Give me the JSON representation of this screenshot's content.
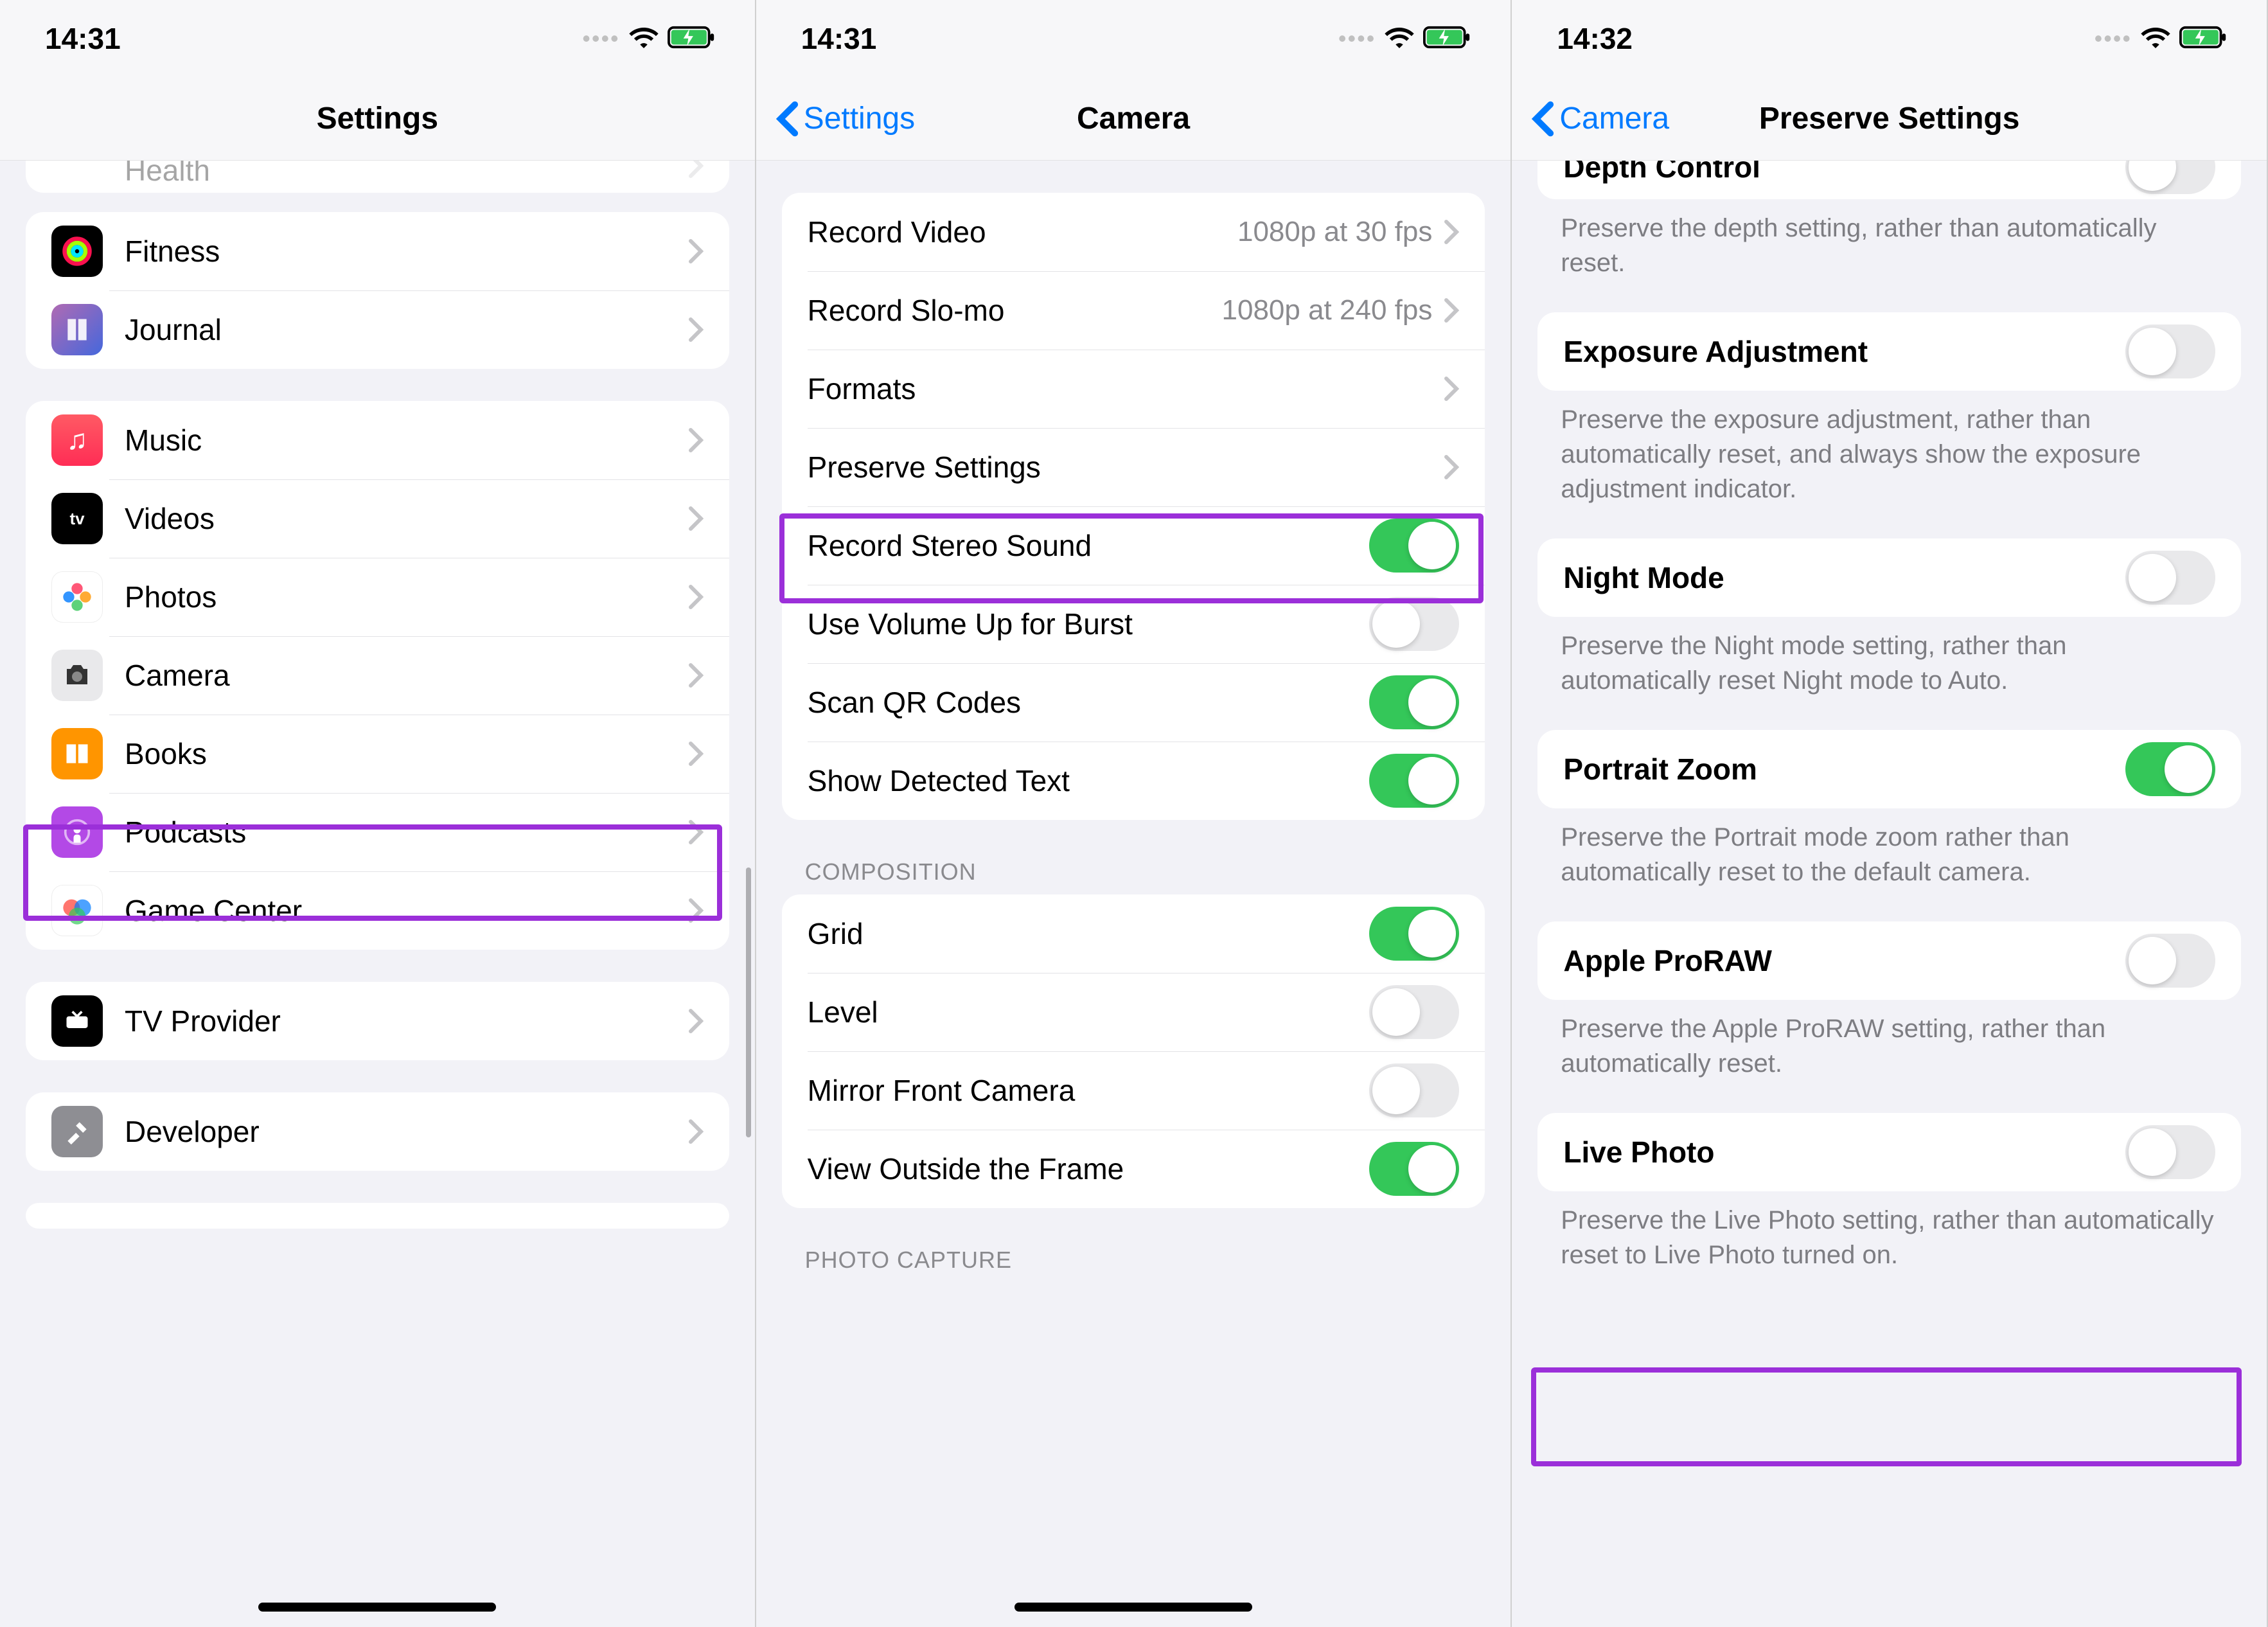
{
  "status": {
    "time1": "14:31",
    "time2": "14:31",
    "time3": "14:32"
  },
  "screen1": {
    "title": "Settings",
    "peek": "Health",
    "group1": [
      {
        "label": "Fitness"
      },
      {
        "label": "Journal"
      }
    ],
    "group2": [
      {
        "label": "Music"
      },
      {
        "label": "Videos"
      },
      {
        "label": "Photos"
      },
      {
        "label": "Camera"
      },
      {
        "label": "Books"
      },
      {
        "label": "Podcasts"
      },
      {
        "label": "Game Center"
      }
    ],
    "group3": [
      {
        "label": "TV Provider"
      }
    ],
    "group4": [
      {
        "label": "Developer"
      }
    ]
  },
  "screen2": {
    "back": "Settings",
    "title": "Camera",
    "group1": [
      {
        "label": "Record Video",
        "detail": "1080p at 30 fps"
      },
      {
        "label": "Record Slo-mo",
        "detail": "1080p at 240 fps"
      },
      {
        "label": "Formats"
      },
      {
        "label": "Preserve Settings"
      },
      {
        "label": "Record Stereo Sound",
        "toggle": true
      },
      {
        "label": "Use Volume Up for Burst",
        "toggle": false
      },
      {
        "label": "Scan QR Codes",
        "toggle": true
      },
      {
        "label": "Show Detected Text",
        "toggle": true
      }
    ],
    "sectionA": "COMPOSITION",
    "group2": [
      {
        "label": "Grid",
        "toggle": true
      },
      {
        "label": "Level",
        "toggle": false
      },
      {
        "label": "Mirror Front Camera",
        "toggle": false
      },
      {
        "label": "View Outside the Frame",
        "toggle": true
      }
    ],
    "sectionB": "PHOTO CAPTURE"
  },
  "screen3": {
    "back": "Camera",
    "title": "Preserve Settings",
    "items": [
      {
        "label": "Depth Control",
        "toggle": false,
        "footer": "Preserve the depth setting, rather than automatically reset."
      },
      {
        "label": "Exposure Adjustment",
        "toggle": false,
        "footer": "Preserve the exposure adjustment, rather than automatically reset, and always show the exposure adjustment indicator."
      },
      {
        "label": "Night Mode",
        "toggle": false,
        "footer": "Preserve the Night mode setting, rather than automatically reset Night mode to Auto."
      },
      {
        "label": "Portrait Zoom",
        "toggle": true,
        "footer": "Preserve the Portrait mode zoom rather than automatically reset to the default camera."
      },
      {
        "label": "Apple ProRAW",
        "toggle": false,
        "footer": "Preserve the Apple ProRAW setting, rather than automatically reset."
      },
      {
        "label": "Live Photo",
        "toggle": false,
        "footer": "Preserve the Live Photo setting, rather than automatically reset to Live Photo turned on."
      }
    ]
  }
}
